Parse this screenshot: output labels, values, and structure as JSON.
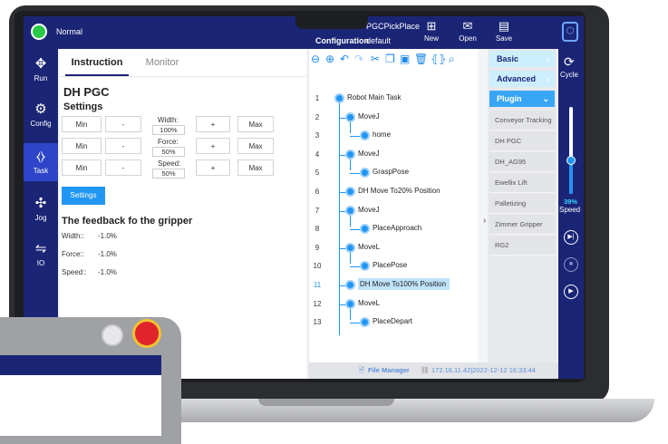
{
  "topbar": {
    "mode": "Normal",
    "task_label": "Task",
    "task_value": "PGCPickPlace",
    "config_label": "Configuration",
    "config_value": "default",
    "buttons": [
      {
        "label": "New",
        "icon": "new-file-icon"
      },
      {
        "label": "Open",
        "icon": "open-folder-icon"
      },
      {
        "label": "Save",
        "icon": "save-icon"
      }
    ]
  },
  "leftnav": [
    {
      "label": "Run",
      "icon": "run-icon"
    },
    {
      "label": "Config",
      "icon": "gear-icon"
    },
    {
      "label": "Task",
      "icon": "code-icon",
      "active": true
    },
    {
      "label": "Jog",
      "icon": "move-arrows-icon"
    },
    {
      "label": "IO",
      "icon": "io-icon"
    }
  ],
  "instruction": {
    "tabs": [
      "Instruction",
      "Monitor"
    ],
    "title": "DH PGC",
    "settings_heading": "Settings",
    "rows": [
      {
        "min": "Min",
        "minus": "-",
        "label": "Width:",
        "value": "100%",
        "plus": "+",
        "max": "Max"
      },
      {
        "min": "Min",
        "minus": "-",
        "label": "Force:",
        "value": "50%",
        "plus": "+",
        "max": "Max"
      },
      {
        "min": "Min",
        "minus": "-",
        "label": "Speed:",
        "value": "50%",
        "plus": "+",
        "max": "Max"
      }
    ],
    "settings_button": "Settings",
    "feedback_heading": "The feedback fo the gripper",
    "feedback": [
      {
        "label": "Width::",
        "value": "-1.0%"
      },
      {
        "label": "Force::",
        "value": "-1.0%"
      },
      {
        "label": "Speed::",
        "value": "-1.0%"
      }
    ]
  },
  "tree": {
    "nodes": [
      {
        "line": "1",
        "label": "Robot Main Task",
        "depth": 0
      },
      {
        "line": "2",
        "label": "MoveJ",
        "depth": 1
      },
      {
        "line": "3",
        "label": "home",
        "depth": 2
      },
      {
        "line": "4",
        "label": "MoveJ",
        "depth": 1
      },
      {
        "line": "5",
        "label": "GraspPose",
        "depth": 2
      },
      {
        "line": "6",
        "label": "DH Move To20% Position",
        "depth": 1
      },
      {
        "line": "7",
        "label": "MoveJ",
        "depth": 1
      },
      {
        "line": "8",
        "label": "PlaceApproach",
        "depth": 2
      },
      {
        "line": "9",
        "label": "MoveL",
        "depth": 1
      },
      {
        "line": "10",
        "label": "PlacePose",
        "depth": 2
      },
      {
        "line": "11",
        "label": "DH Move To100% Position",
        "depth": 1,
        "selected": true
      },
      {
        "line": "12",
        "label": "MoveL",
        "depth": 1
      },
      {
        "line": "13",
        "label": "PlaceDepart",
        "depth": 2
      }
    ],
    "collapse_arrow": "›"
  },
  "sidelist": {
    "categories": [
      "Basic",
      "Advanced",
      "Plugin"
    ],
    "plugins": [
      "Conveyor Tracking",
      "DH PGC",
      "DH_AG95",
      "Ewellix Lift",
      "Palletizing",
      "Zimmer Gripper",
      "RG2"
    ]
  },
  "rightbar": {
    "cycle_label": "Cycle",
    "speed_value": "39%",
    "speed_label": "Speed",
    "speed_fraction": 0.39
  },
  "statusbar": {
    "file_manager": "File Manager",
    "ip_time": "172.16.11.42|2022-12-12 16:33:44"
  },
  "colors": {
    "navy": "#1b2576",
    "accent": "#2196f3",
    "active_nav": "#2e44c9",
    "status_green": "#29c947"
  }
}
